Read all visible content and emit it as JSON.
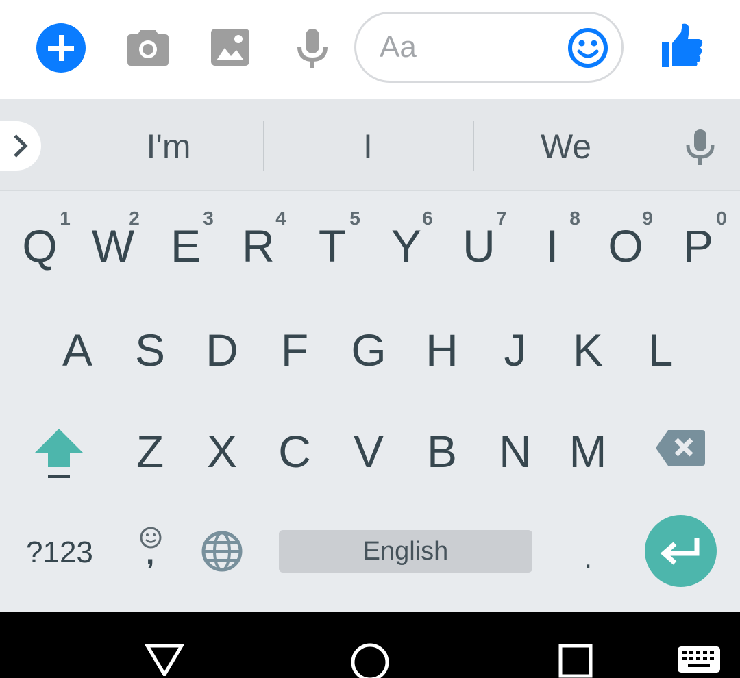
{
  "composer": {
    "placeholder": "Aa",
    "icons": [
      "plus-icon",
      "camera-icon",
      "gallery-icon",
      "microphone-icon",
      "emoji-icon",
      "thumbs-up-icon"
    ],
    "accent_color": "#0a7cff"
  },
  "suggestions": {
    "words": [
      "I'm",
      "I",
      "We"
    ],
    "icons": [
      "chevron-right-icon",
      "microphone-icon"
    ]
  },
  "keyboard": {
    "row1": [
      "Q",
      "W",
      "E",
      "R",
      "T",
      "Y",
      "U",
      "I",
      "O",
      "P"
    ],
    "row1_hints": [
      "1",
      "2",
      "3",
      "4",
      "5",
      "6",
      "7",
      "8",
      "9",
      "0"
    ],
    "row2": [
      "A",
      "S",
      "D",
      "F",
      "G",
      "H",
      "J",
      "K",
      "L"
    ],
    "row3": [
      "Z",
      "X",
      "C",
      "V",
      "B",
      "N",
      "M"
    ],
    "symbols_label": "?123",
    "comma_label": ",",
    "space_label": "English",
    "period_label": ".",
    "accent_color": "#4db6ac"
  },
  "navbar": {
    "icons": [
      "back-icon",
      "home-icon",
      "recents-icon",
      "keyboard-switch-icon"
    ]
  }
}
